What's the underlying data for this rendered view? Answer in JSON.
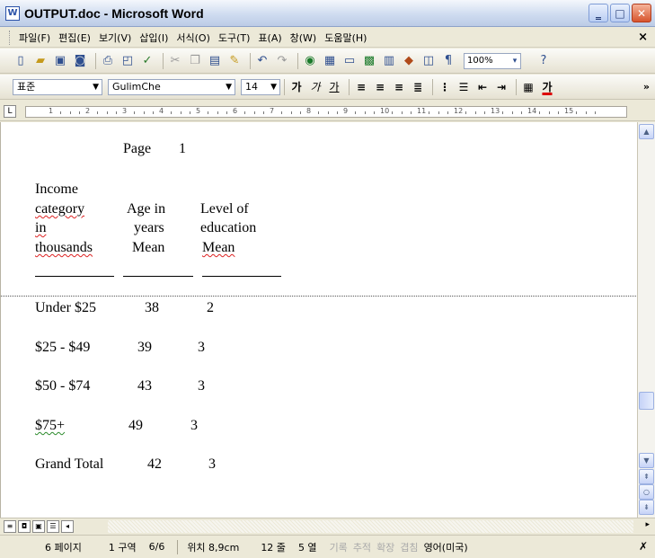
{
  "window": {
    "title": "OUTPUT.doc - Microsoft Word",
    "app_icon_glyph": "W"
  },
  "menu": {
    "items": [
      "파일(F)",
      "편집(E)",
      "보기(V)",
      "삽입(I)",
      "서식(O)",
      "도구(T)",
      "표(A)",
      "창(W)",
      "도움말(H)"
    ],
    "close_glyph": "×"
  },
  "toolbar_standard": {
    "zoom": "100%"
  },
  "toolbar_format": {
    "style": "표준",
    "font": "GulimChe",
    "size": "14"
  },
  "ruler": {
    "numbers": [
      "1",
      "2",
      "3",
      "4",
      "5",
      "6",
      "7",
      "8",
      "9",
      "10",
      "11",
      "12",
      "13",
      "14",
      "15"
    ]
  },
  "document": {
    "page_label": "Page",
    "page_number": "1",
    "headers": {
      "col1": [
        "Income",
        "category",
        "in",
        "thousands"
      ],
      "col2": [
        "Age in",
        "years",
        "Mean"
      ],
      "col3": [
        "Level of",
        "education",
        "Mean"
      ]
    },
    "rows": [
      {
        "category": "Under $25",
        "age": "38",
        "edu": "2"
      },
      {
        "category": "$25 - $49",
        "age": "39",
        "edu": "3"
      },
      {
        "category": "$50 - $74",
        "age": "43",
        "edu": "3"
      },
      {
        "category": "$75+",
        "age": "49",
        "edu": "3"
      },
      {
        "category": "Grand Total",
        "age": "42",
        "edu": "3"
      }
    ]
  },
  "status": {
    "page": "6 페이지",
    "section": "1 구역",
    "pages": "6/6",
    "position": "위치 8,9cm",
    "line": "12 줄",
    "column": "5 열",
    "rec": "기록",
    "trk": "추적",
    "ext": "확장",
    "ovr": "겹침",
    "lang": "영어(미국)"
  }
}
